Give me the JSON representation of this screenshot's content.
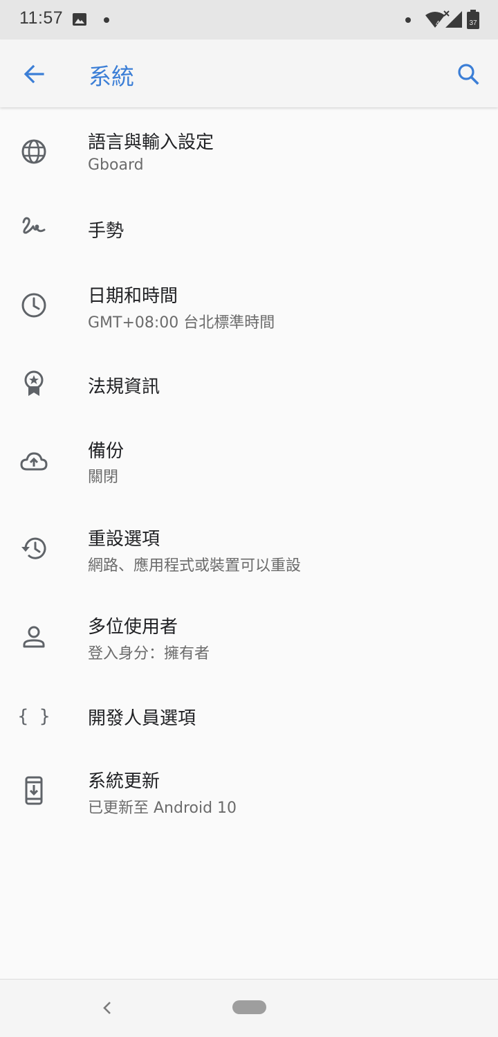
{
  "status_bar": {
    "time": "11:57",
    "battery_level": "37",
    "network_type": "4",
    "icons": [
      "image-icon",
      "notification-dot-icon",
      "wifi-icon",
      "signal-icon",
      "battery-icon"
    ]
  },
  "app_bar": {
    "title": "系統"
  },
  "items": [
    {
      "title": "語言與輸入設定",
      "subtitle": "Gboard",
      "icon": "globe-icon"
    },
    {
      "title": "手勢",
      "subtitle": "",
      "icon": "gesture-icon"
    },
    {
      "title": "日期和時間",
      "subtitle": "GMT+08:00 台北標準時間",
      "icon": "clock-icon"
    },
    {
      "title": "法規資訊",
      "subtitle": "",
      "icon": "badge-icon"
    },
    {
      "title": "備份",
      "subtitle": "關閉",
      "icon": "cloud-upload-icon"
    },
    {
      "title": "重設選項",
      "subtitle": "網路、應用程式或裝置可以重設",
      "icon": "history-icon"
    },
    {
      "title": "多位使用者",
      "subtitle": "登入身分：擁有者",
      "icon": "person-icon"
    },
    {
      "title": "開發人員選項",
      "subtitle": "",
      "icon": "braces-icon"
    },
    {
      "title": "系統更新",
      "subtitle": "已更新至 Android 10",
      "icon": "system-update-icon"
    }
  ],
  "colors": {
    "accent": "#3b7ed6",
    "icon": "#5f6368",
    "title_text": "#202124",
    "subtitle_text": "#6b6b6b"
  }
}
